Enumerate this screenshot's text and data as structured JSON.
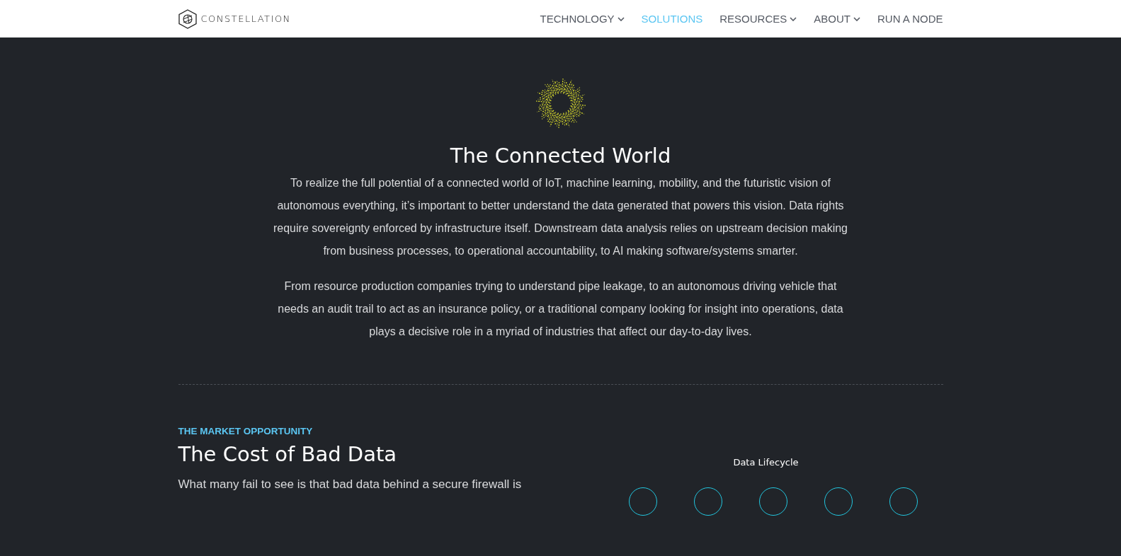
{
  "header": {
    "logo_text": "CONSTELLATION",
    "nav": [
      {
        "label": "TECHNOLOGY",
        "selected": false,
        "dropdown": true
      },
      {
        "label": "SOLUTIONS",
        "selected": true,
        "dropdown": false
      },
      {
        "label": "RESOURCES",
        "selected": false,
        "dropdown": true
      },
      {
        "label": "ABOUT",
        "selected": false,
        "dropdown": true
      },
      {
        "label": "RUN A NODE",
        "selected": false,
        "dropdown": false
      }
    ]
  },
  "intro": {
    "title": "The Connected World",
    "paragraphs": [
      "To realize the full potential of a connected world of IoT, machine learning, mobility, and the futuristic vision of autonomous everything, it’s important to better understand the data generated that powers this vision. Data rights require sovereignty enforced by infrastructure itself. Downstream data analysis relies on upstream decision making from business processes, to operational accountability, to AI making software/systems smarter.",
      "From resource production companies trying to understand pipe leakage, to an autonomous driving vehicle that needs an audit trail to act as an insurance policy, or a traditional company looking for insight into operations, data plays a decisive role in a myriad of industries that affect our day-to-day lives."
    ]
  },
  "market": {
    "eyebrow": "THE MARKET OPPORTUNITY",
    "title": "The Cost of Bad Data",
    "body": "What many fail to see is that bad data behind a secure firewall is"
  },
  "lifecycle": {
    "title": "Data Lifecycle"
  }
}
